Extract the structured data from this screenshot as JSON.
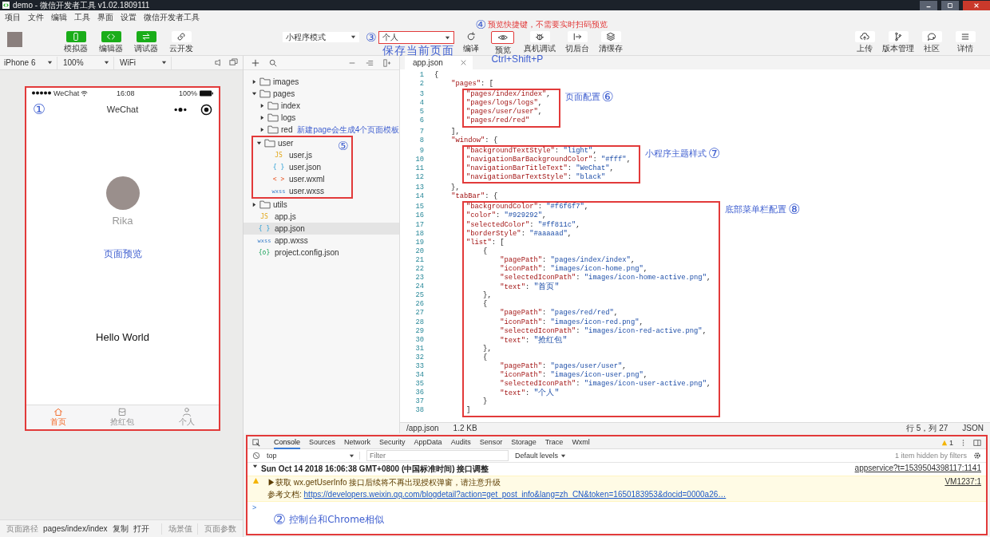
{
  "window": {
    "title": "demo - 微信开发者工具 v1.02.1809111"
  },
  "menu": [
    "项目",
    "文件",
    "编辑",
    "工具",
    "界面",
    "设置",
    "微信开发者工具"
  ],
  "toolbar": {
    "views": [
      {
        "label": "模拟器",
        "kind": "phone",
        "selected": true
      },
      {
        "label": "编辑器",
        "kind": "code",
        "selected": true
      },
      {
        "label": "调试器",
        "kind": "debug",
        "selected": true
      },
      {
        "label": "云开发",
        "kind": "cloud",
        "selected": false
      }
    ],
    "mode": "小程序模式",
    "compile": {
      "value": "个人",
      "callout": {
        "number": "③",
        "note": "保存当前页面"
      }
    },
    "actions": [
      {
        "label": "编译",
        "kind": "refresh"
      },
      {
        "label": "预览",
        "kind": "eye",
        "callout": {
          "number": "④",
          "note": "预览快捷键，不需要实时扫码预览",
          "shortcut": "Ctrl+Shift+P"
        }
      },
      {
        "label": "真机调试",
        "kind": "bug"
      },
      {
        "label": "切后台",
        "kind": "switch"
      },
      {
        "label": "清缓存",
        "kind": "layers"
      }
    ],
    "right": [
      {
        "label": "上传",
        "kind": "upload"
      },
      {
        "label": "版本管理",
        "kind": "branch"
      },
      {
        "label": "社区",
        "kind": "chat"
      },
      {
        "label": "详情",
        "kind": "menu"
      }
    ]
  },
  "simulator": {
    "device": "iPhone 6",
    "zoom": "100%",
    "network": "WiFi",
    "callout": {
      "number": "①"
    },
    "carrier": "WeChat",
    "time": "16:08",
    "battery": "100%",
    "nav_title": "WeChat",
    "user_name": "Rika",
    "preview_label": "页面预览",
    "greeting": "Hello World",
    "tabs": [
      {
        "label": "首页",
        "kind": "home",
        "selected": true
      },
      {
        "label": "抢红包",
        "kind": "gift",
        "selected": false
      },
      {
        "label": "个人",
        "kind": "user",
        "selected": false
      }
    ]
  },
  "files": {
    "items": [
      {
        "name": "images",
        "kind": "folder",
        "expanded": false,
        "selected": false
      },
      {
        "name": "pages",
        "kind": "folder",
        "expanded": true,
        "selected": false,
        "children": [
          {
            "name": "index",
            "kind": "folder",
            "expanded": false,
            "selected": false
          },
          {
            "name": "logs",
            "kind": "folder",
            "expanded": false,
            "selected": false
          },
          {
            "name": "red",
            "kind": "folder",
            "expanded": false,
            "selected": false,
            "note": "新建page会生成4个页面模板"
          },
          {
            "name": "user",
            "kind": "folder",
            "expanded": true,
            "selected": false,
            "callout": {
              "number": "⑤"
            },
            "children": [
              {
                "name": "user.js",
                "kind": "js",
                "icon": "JS",
                "selected": false
              },
              {
                "name": "user.json",
                "kind": "json",
                "icon": "{ }",
                "selected": false
              },
              {
                "name": "user.wxml",
                "kind": "wxml",
                "icon": "< >",
                "selected": false
              },
              {
                "name": "user.wxss",
                "kind": "wxss",
                "icon": "wxss",
                "selected": false
              }
            ]
          }
        ]
      },
      {
        "name": "utils",
        "kind": "folder",
        "expanded": false,
        "selected": false
      },
      {
        "name": "app.js",
        "kind": "js",
        "icon": "JS",
        "selected": false
      },
      {
        "name": "app.json",
        "kind": "json",
        "icon": "{ }",
        "selected": true
      },
      {
        "name": "app.wxss",
        "kind": "wxss",
        "icon": "wxss",
        "selected": false
      },
      {
        "name": "project.config.json",
        "kind": "config",
        "icon": "{o}",
        "selected": false
      }
    ]
  },
  "editor": {
    "tab": "app.json",
    "blocks": [
      {
        "lines": [
          {
            "n": "1",
            "code": "{"
          },
          {
            "n": "2",
            "code": "    \"pages\": ["
          }
        ]
      },
      {
        "callout": {
          "note": "页面配置",
          "number": "⑥"
        },
        "lines": [
          {
            "n": "3",
            "code": "\"pages/index/index\","
          },
          {
            "n": "4",
            "code": "\"pages/logs/logs\","
          },
          {
            "n": "5",
            "code": "\"pages/user/user\","
          },
          {
            "n": "6",
            "code": "\"pages/red/red\""
          }
        ]
      },
      {
        "lines": [
          {
            "n": "7",
            "code": "    ],"
          },
          {
            "n": "8",
            "code": "    \"window\": {"
          }
        ]
      },
      {
        "callout": {
          "note": "小程序主题样式",
          "number": "⑦"
        },
        "lines": [
          {
            "n": "9",
            "code": "\"backgroundTextStyle\": \"light\","
          },
          {
            "n": "10",
            "code": "\"navigationBarBackgroundColor\": \"#fff\","
          },
          {
            "n": "11",
            "code": "\"navigationBarTitleText\": \"WeChat\","
          },
          {
            "n": "12",
            "code": "\"navigationBarTextStyle\": \"black\""
          }
        ]
      },
      {
        "lines": [
          {
            "n": "13",
            "code": "    },"
          },
          {
            "n": "14",
            "code": "    \"tabBar\": {"
          }
        ]
      },
      {
        "callout": {
          "note": "底部菜单栏配置",
          "number": "⑧"
        },
        "lines": [
          {
            "n": "15",
            "code": "\"backgroundColor\": \"#f6f6f7\","
          },
          {
            "n": "16",
            "code": "\"color\": \"#929292\","
          },
          {
            "n": "17",
            "code": "\"selectedColor\": \"#ff811c\","
          },
          {
            "n": "18",
            "code": "\"borderStyle\": \"#aaaaad\","
          },
          {
            "n": "19",
            "code": "\"list\": ["
          },
          {
            "n": "20",
            "code": "    {"
          },
          {
            "n": "21",
            "code": "        \"pagePath\": \"pages/index/index\","
          },
          {
            "n": "22",
            "code": "        \"iconPath\": \"images/icon-home.png\","
          },
          {
            "n": "23",
            "code": "        \"selectedIconPath\": \"images/icon-home-active.png\","
          },
          {
            "n": "24",
            "code": "        \"text\": \"首页\""
          },
          {
            "n": "25",
            "code": "    },"
          },
          {
            "n": "26",
            "code": "    {"
          },
          {
            "n": "27",
            "code": "        \"pagePath\": \"pages/red/red\","
          },
          {
            "n": "28",
            "code": "        \"iconPath\": \"images/icon-red.png\","
          },
          {
            "n": "29",
            "code": "        \"selectedIconPath\": \"images/icon-red-active.png\","
          },
          {
            "n": "30",
            "code": "        \"text\": \"抢红包\""
          },
          {
            "n": "31",
            "code": "    },"
          },
          {
            "n": "32",
            "code": "    {"
          },
          {
            "n": "33",
            "code": "        \"pagePath\": \"pages/user/user\","
          },
          {
            "n": "34",
            "code": "        \"iconPath\": \"images/icon-user.png\","
          },
          {
            "n": "35",
            "code": "        \"selectedIconPath\": \"images/icon-user-active.png\","
          },
          {
            "n": "36",
            "code": "        \"text\": \"个人\""
          },
          {
            "n": "37",
            "code": "    }"
          },
          {
            "n": "38",
            "code": "]"
          }
        ]
      }
    ],
    "status": {
      "path": "/app.json",
      "size": "1.2 KB",
      "position": "行 5，列 27",
      "language": "JSON"
    }
  },
  "console": {
    "callout": {
      "number": "②",
      "note": "控制台和Chrome相似"
    },
    "tabs": [
      {
        "label": "Console",
        "selected": true
      },
      {
        "label": "Sources",
        "selected": false
      },
      {
        "label": "Network",
        "selected": false
      },
      {
        "label": "Security",
        "selected": false
      },
      {
        "label": "AppData",
        "selected": false
      },
      {
        "label": "Audits",
        "selected": false
      },
      {
        "label": "Sensor",
        "selected": false
      },
      {
        "label": "Storage",
        "selected": false
      },
      {
        "label": "Trace",
        "selected": false
      },
      {
        "label": "Wxml",
        "selected": false
      }
    ],
    "warning_count": "1",
    "context": "top",
    "filter_placeholder": "Filter",
    "levels": "Default levels",
    "hidden_note": "1 item hidden by filters",
    "messages": [
      {
        "kind": "group",
        "expanded": true,
        "text": "Sun Oct 14 2018 16:06:38 GMT+0800 (中国标准时间) 接口调整",
        "source": "appservice?t=1539504398117:1141"
      },
      {
        "kind": "warning",
        "text": "▶获取 wx.getUserInfo 接口后续将不再出现授权弹窗，请注意升级",
        "detail": "参考文档: ",
        "link": "https://developers.weixin.qq.com/blogdetail?action=get_post_info&lang=zh_CN&token=1650183953&docid=0000a26…",
        "source": "VM1237:1"
      }
    ],
    "prompt": ">"
  },
  "status_bar": {
    "path_label": "页面路径",
    "path": "pages/index/index",
    "copy": "复制",
    "open": "打开",
    "scene": "场景值",
    "params": "页面参数"
  }
}
